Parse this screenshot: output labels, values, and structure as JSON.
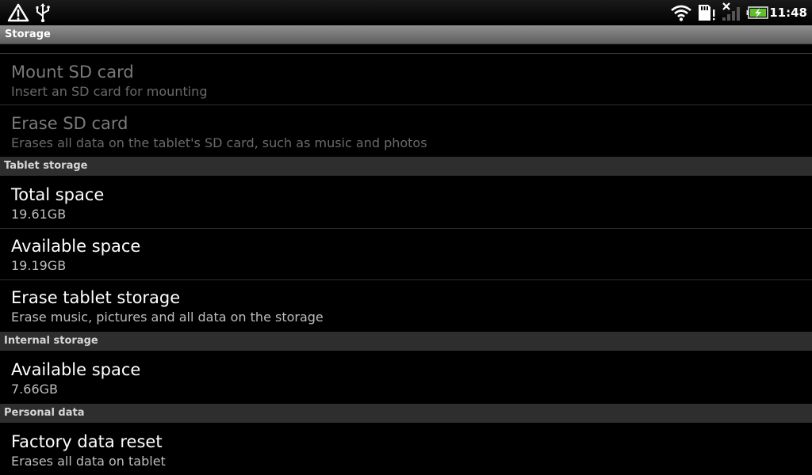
{
  "status_bar": {
    "left_icons": [
      "warning-icon",
      "usb-icon"
    ],
    "right_icons": [
      "wifi-icon",
      "sd-card-icon",
      "signal-icon",
      "battery-charging-icon"
    ],
    "time": "11:48",
    "colors": {
      "battery_fill": "#5ec22b"
    }
  },
  "title_bar": {
    "title": "Storage"
  },
  "sd_card": {
    "mount": {
      "title": "Mount SD card",
      "subtitle": "Insert an SD card for mounting"
    },
    "erase": {
      "title": "Erase SD card",
      "subtitle": "Erases all data on the tablet's SD card, such as music and photos"
    }
  },
  "tablet_storage": {
    "header": "Tablet storage",
    "total": {
      "title": "Total space",
      "value": "19.61GB"
    },
    "available": {
      "title": "Available space",
      "value": "19.19GB"
    },
    "erase": {
      "title": "Erase tablet storage",
      "subtitle": "Erase music, pictures and all data on the storage"
    }
  },
  "internal_storage": {
    "header": "Internal storage",
    "available": {
      "title": "Available space",
      "value": "7.66GB"
    }
  },
  "personal_data": {
    "header": "Personal data",
    "factory_reset": {
      "title": "Factory data reset",
      "subtitle": "Erases all data on tablet"
    }
  }
}
